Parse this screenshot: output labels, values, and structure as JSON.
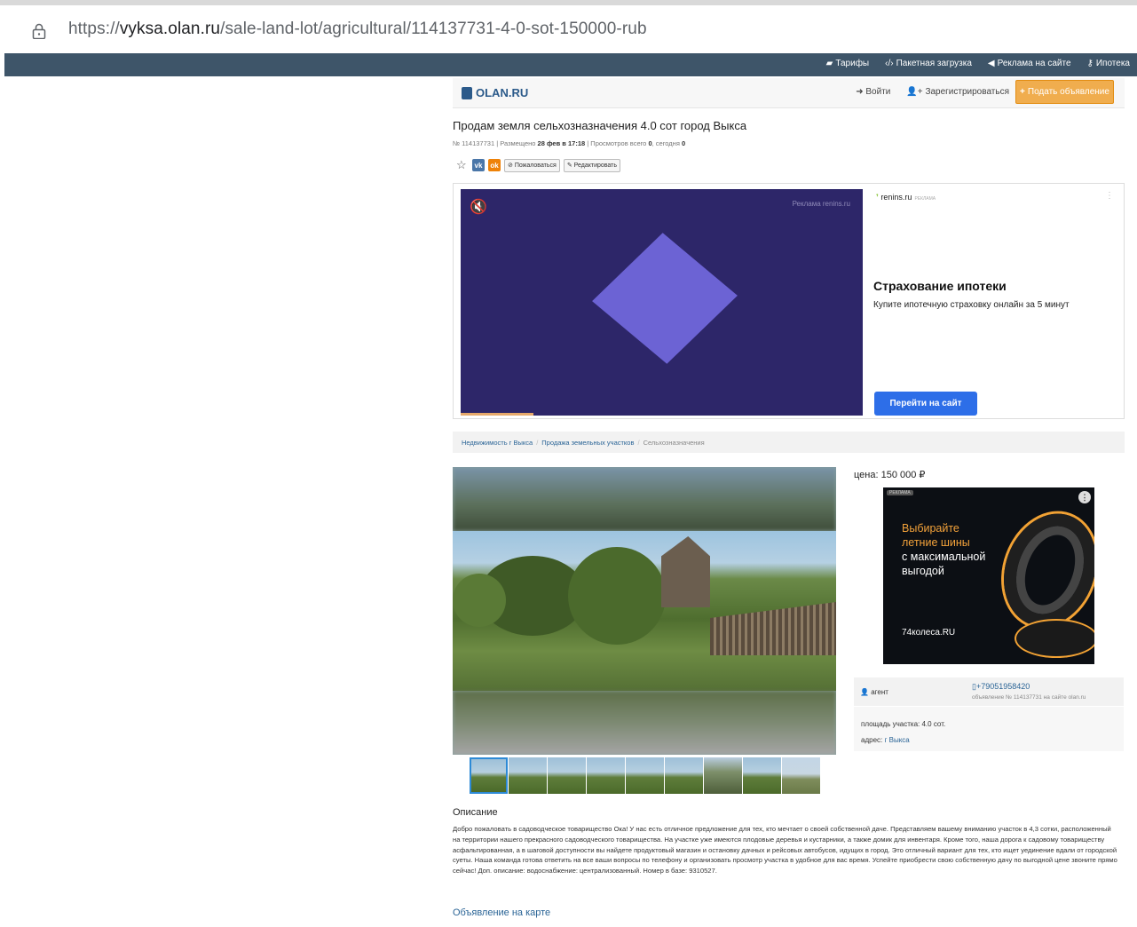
{
  "browser": {
    "url_prefix": "https://",
    "url_host": "vyksa.olan.ru",
    "url_path": "/sale-land-lot/agricultural/114137731-4-0-sot-150000-rub"
  },
  "topnav": {
    "items": [
      {
        "icon": "tariff-icon",
        "label": "Тарифы"
      },
      {
        "icon": "code-icon",
        "label": "Пакетная загрузка"
      },
      {
        "icon": "megaphone-icon",
        "label": "Реклама на сайте"
      },
      {
        "icon": "key-icon",
        "label": "Ипотека"
      }
    ]
  },
  "header": {
    "logo": "OLAN.RU",
    "login": "Войти",
    "register": "Зарегистрироваться",
    "post_ad": "Подать объявление"
  },
  "listing": {
    "title": "Продам земля сельхозназначения 4.0 сот город Выкса",
    "meta_number": "№ 114137731",
    "meta_posted_label": "Размещено",
    "meta_posted": "28 фев в 17:18",
    "meta_views_label": "Просмотров всего",
    "meta_views_total": "0",
    "meta_today_label": "сегодня",
    "meta_views_today": "0",
    "complain": "Пожаловаться",
    "edit": "Редактировать"
  },
  "ad_banner": {
    "video_label": "Реклама renins.ru",
    "source": "renins.ru",
    "source_tag": "РЕКЛАМА",
    "headline": "Страхование ипотеки",
    "subtext": "Купите ипотечную страховку онлайн за 5 минут",
    "button": "Перейти на сайт",
    "video_progress": 0.18
  },
  "breadcrumbs": [
    "Недвижимость г Выкса",
    "Продажа земельных участков",
    "Сельхозназначения"
  ],
  "price": "цена: 150 000 ₽",
  "ad_side": {
    "tag": "РЕКЛАМА",
    "line1": "Выбирайте",
    "line2": "летние шины",
    "line3": "с максимальной",
    "line4": "выгодой",
    "brand": "74колеса.RU"
  },
  "contact": {
    "role": "агент",
    "phone": "+79051958420",
    "ad_number": "объявление № 114137731 на сайте olan.ru"
  },
  "details": {
    "area": "площадь участка: 4.0 сот.",
    "address_label": "адрес:",
    "address_value": "г Выкса"
  },
  "thumbnails_count": 9,
  "description": {
    "heading": "Описание",
    "text": "Добро пожаловать в садоводческое товарищество Ока! У нас есть отличное предложение для тех, кто мечтает о своей собственной даче. Представляем вашему вниманию участок в 4,3 сотки, расположенный на территории нашего прекрасного садоводческого товарищества. На участке уже имеются плодовые деревья и кустарники, а также домик для инвентаря. Кроме того, наша дорога к садовому товариществу асфальтированная, а в шаговой доступности вы найдете продуктовый магазин и остановку дачных и рейсовых автобусов, идущих в город. Это отличный вариант для тех, кто ищет уединение вдали от городской суеты. Наша команда готова ответить на все ваши вопросы по телефону и организовать просмотр участка в удобное для вас время. Успейте приобрести свою собственную дачу по выгодной цене звоните прямо сейчас! Доп. описание: водоснабжение: централизованный. Номер в базе: 9310527."
  },
  "map_link": "Объявление на карте"
}
